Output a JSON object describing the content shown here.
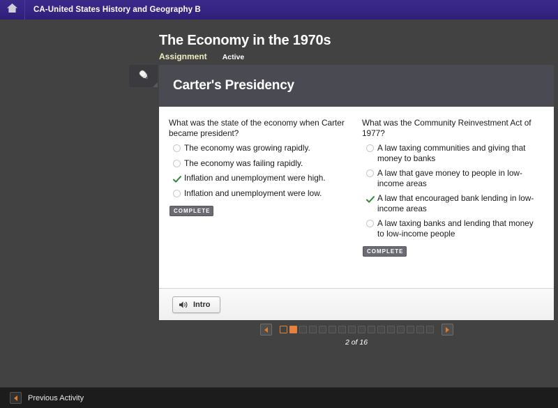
{
  "topbar": {
    "home_icon": "home-icon",
    "course_title": "CA-United States History and Geography B"
  },
  "lesson": {
    "title": "The Economy in the 1970s",
    "type_label": "Assignment",
    "state_label": "Active",
    "edit_tab_icon": "pencil-icon"
  },
  "card": {
    "header_title": "Carter's Presidency",
    "questions": [
      {
        "prompt": "What was the state of the economy when Carter became president?",
        "options": [
          {
            "text": "The economy was growing rapidly.",
            "selected": false
          },
          {
            "text": "The economy was failing rapidly.",
            "selected": false
          },
          {
            "text": "Inflation and unemployment were high.",
            "selected": true
          },
          {
            "text": "Inflation and unemployment were low.",
            "selected": false
          }
        ],
        "status_badge": "COMPLETE"
      },
      {
        "prompt": "What was the Community Reinvestment Act of 1977?",
        "options": [
          {
            "text": "A law taxing communities and giving that money to banks",
            "selected": false
          },
          {
            "text": "A law that gave money to people in low-income areas",
            "selected": false
          },
          {
            "text": "A law that encouraged bank lending in low-income areas",
            "selected": true
          },
          {
            "text": "A law taxing banks and lending that money to low-income people",
            "selected": false
          }
        ],
        "status_badge": "COMPLETE"
      }
    ],
    "footer": {
      "audio_button_label": "Intro",
      "audio_button_icon": "speaker-icon"
    }
  },
  "pager": {
    "prev_icon": "triangle-left-icon",
    "next_icon": "triangle-right-icon",
    "total_dots": 16,
    "current_index": 2,
    "visited_index": 1,
    "count_label": "2 of 16"
  },
  "bottombar": {
    "previous_activity_label": "Previous Activity",
    "previous_activity_icon": "triangle-left-icon"
  },
  "colors": {
    "topbar_purple": "#372585",
    "page_background": "#424242",
    "card_header_gray": "#4a4a52",
    "accent_orange": "#e8803a",
    "correct_green": "#2e8b3d",
    "meta_cream": "#f0ecc0"
  }
}
